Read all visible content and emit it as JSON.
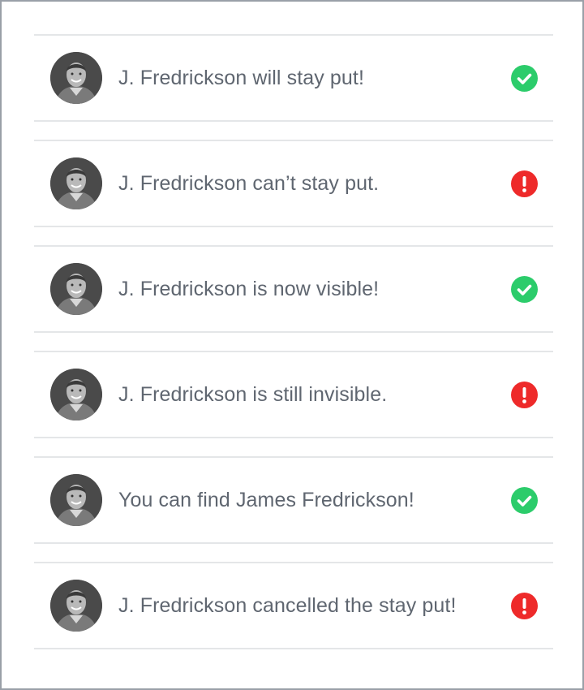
{
  "colors": {
    "success": "#2ccc6b",
    "error": "#ee2a2a",
    "text": "#5f6670",
    "divider": "#e4e6e8",
    "frame_border": "#9aa0a8"
  },
  "notifications": [
    {
      "avatar_icon": "user-avatar",
      "message": "J. Fredrickson will stay put!",
      "status": "success",
      "status_icon": "checkmark-icon"
    },
    {
      "avatar_icon": "user-avatar",
      "message": "J. Fredrickson can’t stay put.",
      "status": "error",
      "status_icon": "exclamation-icon"
    },
    {
      "avatar_icon": "user-avatar",
      "message": "J. Fredrickson is now visible!",
      "status": "success",
      "status_icon": "checkmark-icon"
    },
    {
      "avatar_icon": "user-avatar",
      "message": "J. Fredrickson is still invisible.",
      "status": "error",
      "status_icon": "exclamation-icon"
    },
    {
      "avatar_icon": "user-avatar",
      "message": "You can find James Fredrickson!",
      "status": "success",
      "status_icon": "checkmark-icon"
    },
    {
      "avatar_icon": "user-avatar",
      "message": "J. Fredrickson cancelled the stay put!",
      "status": "error",
      "status_icon": "exclamation-icon"
    }
  ]
}
